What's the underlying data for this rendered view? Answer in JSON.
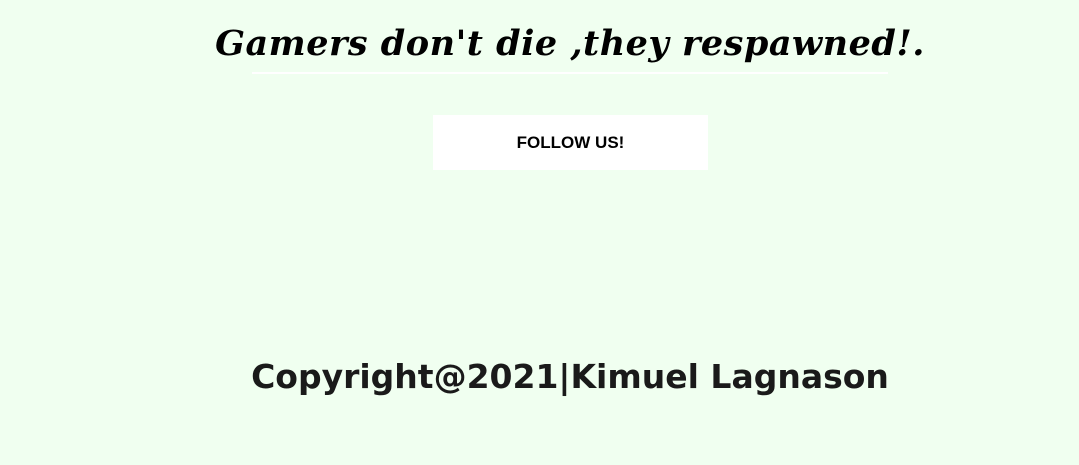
{
  "page": {
    "background_color": "#f0fff0"
  },
  "header": {
    "tagline": "Gamers don't die ,they respawned!."
  },
  "actions": {
    "follow_label": "FOLLOW US!"
  },
  "footer": {
    "copyright": "Copyright@2021|Kimuel Lagnason"
  }
}
